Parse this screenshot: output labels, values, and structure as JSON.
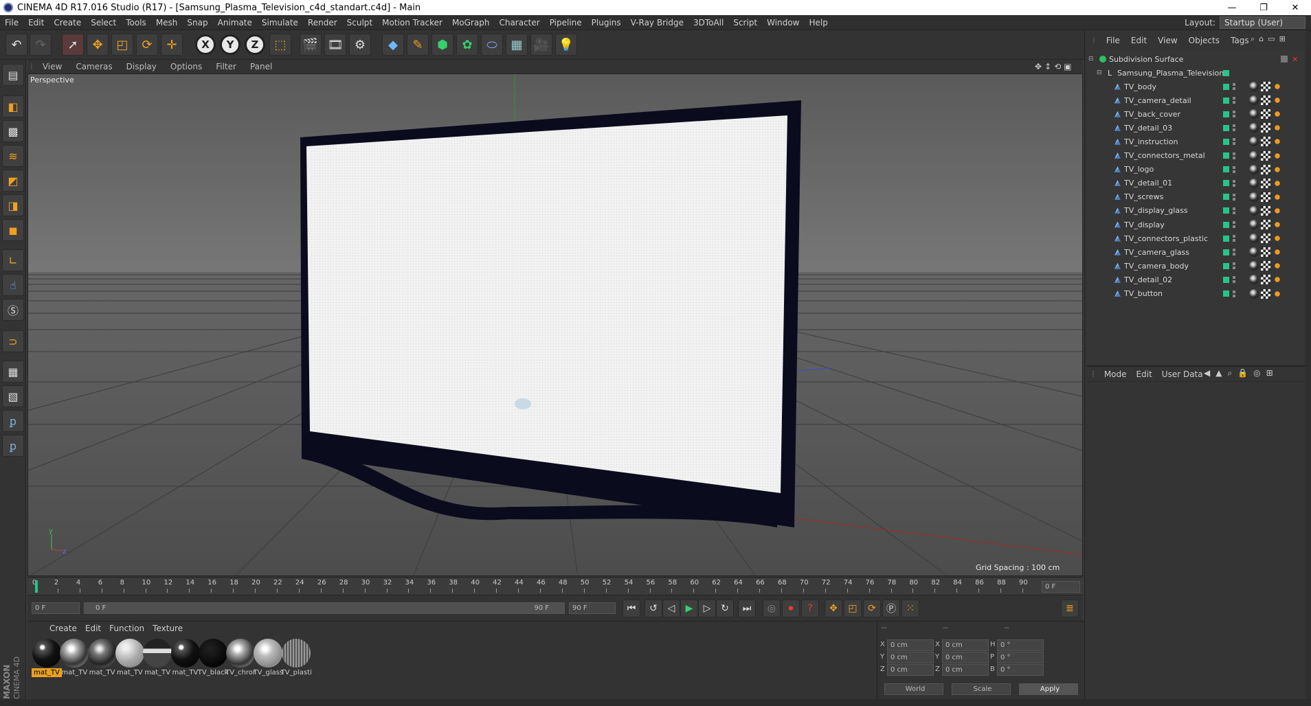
{
  "window": {
    "title": "CINEMA 4D R17.016 Studio (R17) - [Samsung_Plasma_Television_c4d_standart.c4d] - Main",
    "controls": [
      "—",
      "❐",
      "✕"
    ]
  },
  "menu": {
    "items": [
      "File",
      "Edit",
      "Create",
      "Select",
      "Tools",
      "Mesh",
      "Snap",
      "Animate",
      "Simulate",
      "Render",
      "Sculpt",
      "Motion Tracker",
      "MoGraph",
      "Character",
      "Pipeline",
      "Plugins",
      "V-Ray Bridge",
      "3DToAll",
      "Script",
      "Window",
      "Help"
    ],
    "layout_label": "Layout:",
    "layout_value": "Startup (User)"
  },
  "toolbar": {
    "axis_x": "X",
    "axis_y": "Y",
    "axis_z": "Z"
  },
  "viewport": {
    "menu": [
      "View",
      "Cameras",
      "Display",
      "Options",
      "Filter",
      "Panel"
    ],
    "label": "Perspective",
    "grid_spacing": "Grid Spacing : 100 cm",
    "axis_y": "y",
    "axis_z": "z"
  },
  "timeline": {
    "ticks": [
      "0",
      "2",
      "4",
      "6",
      "8",
      "10",
      "12",
      "14",
      "16",
      "18",
      "20",
      "22",
      "24",
      "26",
      "28",
      "30",
      "32",
      "34",
      "36",
      "38",
      "40",
      "42",
      "44",
      "46",
      "48",
      "50",
      "52",
      "54",
      "56",
      "58",
      "60",
      "62",
      "64",
      "66",
      "68",
      "70",
      "72",
      "74",
      "76",
      "78",
      "80",
      "82",
      "84",
      "86",
      "88",
      "90"
    ],
    "current_frame": "0 F",
    "start_frame": "0 F",
    "range_start": "0 F",
    "range_end": "90 F",
    "end_frame": "90 F"
  },
  "materials": {
    "menu": [
      "Create",
      "Edit",
      "Function",
      "Texture"
    ],
    "items": [
      {
        "name": "mat_TV",
        "style": "black-gloss"
      },
      {
        "name": "mat_TV",
        "style": "chrome"
      },
      {
        "name": "mat_TV",
        "style": "dark-chrome"
      },
      {
        "name": "mat_TV",
        "style": "grey"
      },
      {
        "name": "mat_TV",
        "style": "stripe"
      },
      {
        "name": "mat_TV",
        "style": "black-gloss"
      },
      {
        "name": "TV_black",
        "style": "black-matte"
      },
      {
        "name": "TV_chrome",
        "style": "chrome"
      },
      {
        "name": "TV_glass",
        "style": "glass"
      },
      {
        "name": "TV_plastic",
        "style": "textured"
      }
    ]
  },
  "coordinates": {
    "headers": [
      "--",
      "--",
      "--"
    ],
    "rows": [
      {
        "a": "X",
        "av": "0 cm",
        "b": "X",
        "bv": "0 cm",
        "c": "H",
        "cv": "0 °"
      },
      {
        "a": "Y",
        "av": "0 cm",
        "b": "Y",
        "bv": "0 cm",
        "c": "P",
        "cv": "0 °"
      },
      {
        "a": "Z",
        "av": "0 cm",
        "b": "Z",
        "bv": "0 cm",
        "c": "B",
        "cv": "0 °"
      }
    ],
    "mode_world": "World",
    "mode_scale": "Scale",
    "apply": "Apply"
  },
  "objects": {
    "menu": [
      "File",
      "Edit",
      "View",
      "Objects",
      "Tags"
    ],
    "root": "Subdivision Surface",
    "group": "Samsung_Plasma_Television",
    "children": [
      "TV_body",
      "TV_camera_detail",
      "TV_back_cover",
      "TV_detail_03",
      "TV_instruction",
      "TV_connectors_metal",
      "TV_logo",
      "TV_detail_01",
      "TV_screws",
      "TV_display_glass",
      "TV_display",
      "TV_connectors_plastic",
      "TV_camera_glass",
      "TV_camera_body",
      "TV_detail_02",
      "TV_button"
    ]
  },
  "attributes": {
    "menu": [
      "Mode",
      "Edit",
      "User Data"
    ]
  },
  "brand": {
    "line1": "MAXON",
    "line2": "CINEMA 4D"
  },
  "colors": {
    "accent": "#e8a020",
    "object_green": "#27c48a",
    "bezel": "#0b0b1e"
  }
}
